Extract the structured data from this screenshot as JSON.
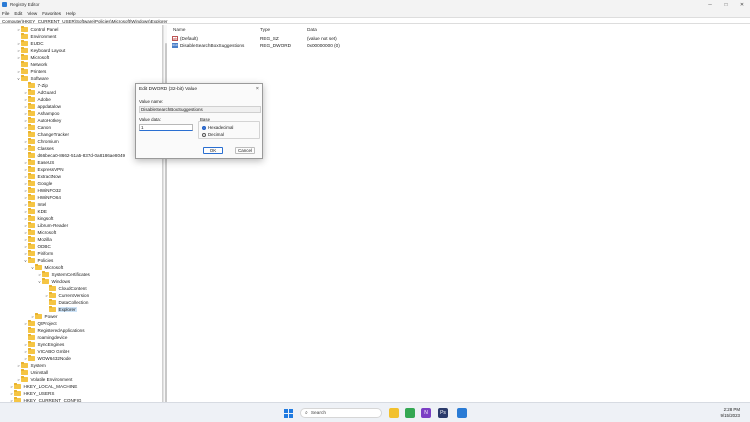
{
  "window": {
    "title": "Registry Editor",
    "controls": [
      "─",
      "□",
      "✕"
    ]
  },
  "menu": [
    "File",
    "Edit",
    "View",
    "Favorites",
    "Help"
  ],
  "address": "Computer\\HKEY_CURRENT_USER\\Software\\Policies\\Microsoft\\Windows\\Explorer",
  "tree": [
    {
      "label": "Control Panel",
      "level": 1,
      "chevron": ">"
    },
    {
      "label": "Environment",
      "level": 1,
      "chevron": ""
    },
    {
      "label": "EUDC",
      "level": 1,
      "chevron": ">"
    },
    {
      "label": "Keyboard Layout",
      "level": 1,
      "chevron": ">"
    },
    {
      "label": "Microsoft",
      "level": 1,
      "chevron": ">"
    },
    {
      "label": "Network",
      "level": 1,
      "chevron": ""
    },
    {
      "label": "Printers",
      "level": 1,
      "chevron": ">"
    },
    {
      "label": "Software",
      "level": 1,
      "chevron": "v"
    },
    {
      "label": "7-Zip",
      "level": 2,
      "chevron": ""
    },
    {
      "label": "AdGuard",
      "level": 2,
      "chevron": ">"
    },
    {
      "label": "Adobe",
      "level": 2,
      "chevron": ">"
    },
    {
      "label": "appdatalow",
      "level": 2,
      "chevron": ">"
    },
    {
      "label": "Ashampoo",
      "level": 2,
      "chevron": ">"
    },
    {
      "label": "AutoHotkey",
      "level": 2,
      "chevron": ">"
    },
    {
      "label": "Canon",
      "level": 2,
      "chevron": ">"
    },
    {
      "label": "ChangeTracker",
      "level": 2,
      "chevron": ""
    },
    {
      "label": "Chromium",
      "level": 2,
      "chevron": ">"
    },
    {
      "label": "Classes",
      "level": 2,
      "chevron": ">"
    },
    {
      "label": "d66beca0-8662-51a5-837d-0a8186ae8049",
      "level": 2,
      "chevron": ""
    },
    {
      "label": "EaseUS",
      "level": 2,
      "chevron": ">"
    },
    {
      "label": "ExpressVPN",
      "level": 2,
      "chevron": ">"
    },
    {
      "label": "ExtractNow",
      "level": 2,
      "chevron": ">"
    },
    {
      "label": "Google",
      "level": 2,
      "chevron": ">"
    },
    {
      "label": "HWiNFO32",
      "level": 2,
      "chevron": ">"
    },
    {
      "label": "HWiNFO64",
      "level": 2,
      "chevron": ">"
    },
    {
      "label": "Intel",
      "level": 2,
      "chevron": ">"
    },
    {
      "label": "KDE",
      "level": 2,
      "chevron": ">"
    },
    {
      "label": "kingsoft",
      "level": 2,
      "chevron": ">"
    },
    {
      "label": "Librum-Reader",
      "level": 2,
      "chevron": ">"
    },
    {
      "label": "Microsoft",
      "level": 2,
      "chevron": ">"
    },
    {
      "label": "Mozilla",
      "level": 2,
      "chevron": ">"
    },
    {
      "label": "ODBC",
      "level": 2,
      "chevron": ">"
    },
    {
      "label": "Piriform",
      "level": 2,
      "chevron": ">"
    },
    {
      "label": "Policies",
      "level": 2,
      "chevron": "v"
    },
    {
      "label": "Microsoft",
      "level": 3,
      "chevron": "v"
    },
    {
      "label": "SystemCertificates",
      "level": 4,
      "chevron": ">"
    },
    {
      "label": "Windows",
      "level": 4,
      "chevron": "v"
    },
    {
      "label": "CloudContent",
      "level": 5,
      "chevron": ""
    },
    {
      "label": "CurrentVersion",
      "level": 5,
      "chevron": ">"
    },
    {
      "label": "DataCollection",
      "level": 5,
      "chevron": ""
    },
    {
      "label": "Explorer",
      "level": 5,
      "chevron": "",
      "selected": true
    },
    {
      "label": "Power",
      "level": 3,
      "chevron": ">"
    },
    {
      "label": "QtProject",
      "level": 2,
      "chevron": ">"
    },
    {
      "label": "RegisteredApplications",
      "level": 2,
      "chevron": ""
    },
    {
      "label": "roamingdevice",
      "level": 2,
      "chevron": ""
    },
    {
      "label": "SyncEngines",
      "level": 2,
      "chevron": ">"
    },
    {
      "label": "VICABO GmbH",
      "level": 2,
      "chevron": ">"
    },
    {
      "label": "WOW6432Node",
      "level": 2,
      "chevron": ">"
    },
    {
      "label": "System",
      "level": 1,
      "chevron": ">"
    },
    {
      "label": "Uninstall",
      "level": 1,
      "chevron": ""
    },
    {
      "label": "Volatile Environment",
      "level": 1,
      "chevron": ">"
    },
    {
      "label": "HKEY_LOCAL_MACHINE",
      "level": 0,
      "chevron": ">"
    },
    {
      "label": "HKEY_USERS",
      "level": 0,
      "chevron": ">"
    },
    {
      "label": "HKEY_CURRENT_CONFIG",
      "level": 0,
      "chevron": ">"
    }
  ],
  "values_pane": {
    "headers": {
      "name": "Name",
      "type": "Type",
      "data": "Data"
    },
    "rows": [
      {
        "icon": "ab",
        "name": "(Default)",
        "type": "REG_SZ",
        "data": "(value not set)"
      },
      {
        "icon": "010",
        "name": "DisableSearchBoxSuggestions",
        "type": "REG_DWORD",
        "data": "0x00000000 (0)"
      }
    ]
  },
  "dialog": {
    "title": "Edit DWORD (32-bit) Value",
    "close": "×",
    "value_name_label": "Value name:",
    "value_name": "DisableSearchBoxSuggestions",
    "value_data_label": "Value data:",
    "value_data": "1",
    "base_label": "Base",
    "base_options": [
      "Hexadecimal",
      "Decimal"
    ],
    "base_selected": "Hexadecimal",
    "ok": "OK",
    "cancel": "Cancel"
  },
  "taskbar": {
    "search_placeholder": "Search",
    "apps": [
      {
        "name": "file-explorer",
        "color": "#f2c12e",
        "glyph": ""
      },
      {
        "name": "chrome",
        "color": "#34a853",
        "glyph": ""
      },
      {
        "name": "onenote",
        "color": "#7b3fc4",
        "glyph": "N"
      },
      {
        "name": "photoshop",
        "color": "#2b3a6b",
        "glyph": "Ps"
      },
      {
        "name": "regedit",
        "color": "#2a7bd5",
        "glyph": ""
      }
    ],
    "time": "2:28 PM",
    "date": "9/15/2023"
  },
  "colors": {
    "folder": "#f5c544",
    "selection": "#cde3f7",
    "accent": "#2a6fd1",
    "taskbar": "#eef1f6"
  }
}
